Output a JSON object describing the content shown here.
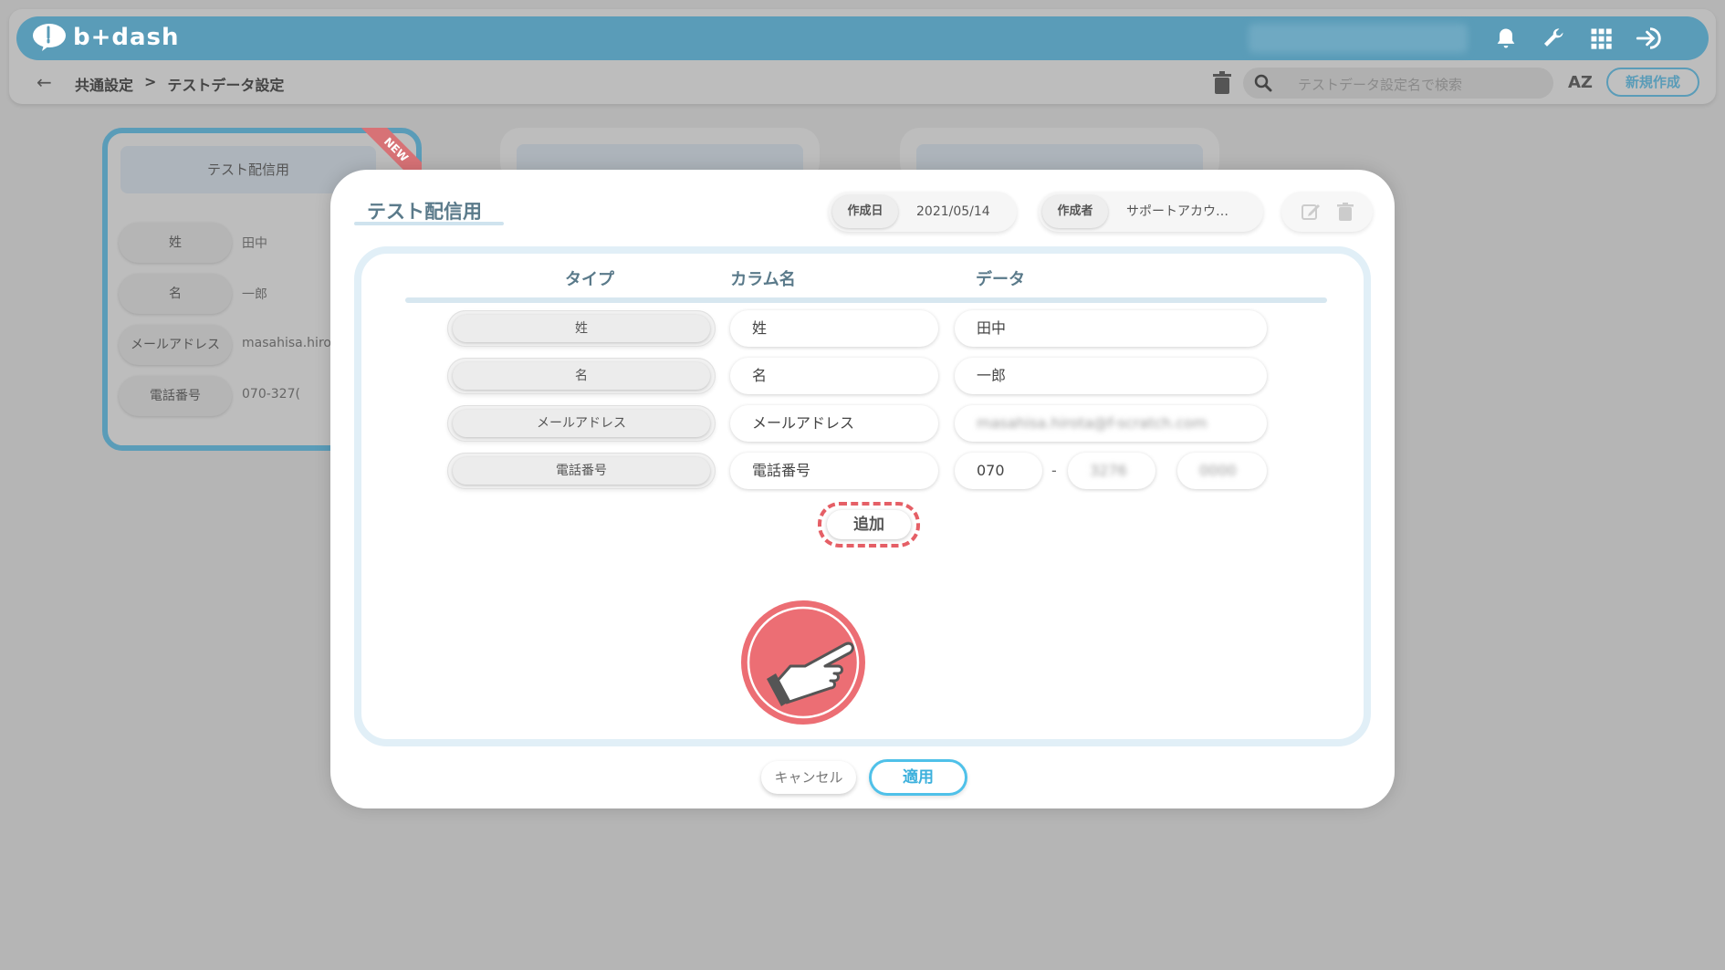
{
  "header": {
    "logo_text": "b+dash",
    "breadcrumb": [
      "共通設定",
      ">",
      "テストデータ設定"
    ],
    "search_placeholder": "テストデータ設定名で検索",
    "sort_label": "AZ",
    "new_button": "新規作成",
    "icons": [
      "bell-icon",
      "wrench-icon",
      "grid-icon",
      "logout-icon",
      "trash-icon",
      "search-icon",
      "back-arrow-icon"
    ]
  },
  "background_card": {
    "title": "テスト配信用",
    "ribbon": "NEW",
    "rows": [
      {
        "label": "姓",
        "value": "田中"
      },
      {
        "label": "名",
        "value": "一郎"
      },
      {
        "label": "メールアドレス",
        "value": "masahisa.hiro"
      },
      {
        "label": "電話番号",
        "value": "070-327("
      }
    ]
  },
  "modal": {
    "title": "テスト配信用",
    "created_date_label": "作成日",
    "created_date": "2021/05/14",
    "creator_label": "作成者",
    "creator": "サポートアカウ…",
    "columns": {
      "type": "タイプ",
      "column_name": "カラム名",
      "data": "データ"
    },
    "rows": [
      {
        "type": "姓",
        "column": "姓",
        "data": "田中"
      },
      {
        "type": "名",
        "column": "名",
        "data": "一郎"
      },
      {
        "type": "メールアドレス",
        "column": "メールアドレス",
        "data": "masahisa.hirota@f-scratch.com"
      },
      {
        "type": "電話番号",
        "column": "電話番号",
        "phone": [
          "070",
          "3276",
          "0000"
        ],
        "separator": "-"
      }
    ],
    "add_button": "追加",
    "cancel_button": "キャンセル",
    "apply_button": "適用"
  },
  "colors": {
    "brand": "#5a9cb8",
    "accent": "#4fc1e9",
    "highlight": "#e55f66",
    "backdrop": "#b5b5b5"
  }
}
